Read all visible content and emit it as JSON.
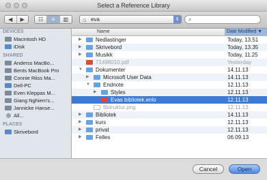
{
  "window": {
    "title": "Select a Reference Library"
  },
  "toolbar": {
    "nav": [
      "◀",
      "▶"
    ],
    "views": [
      "☷",
      "≡",
      "▥"
    ],
    "path": "eva",
    "search_placeholder": ""
  },
  "sidebar": {
    "devices_header": "DEVICES",
    "devices": [
      "Macintosh HD",
      "iDisk"
    ],
    "shared_header": "SHARED",
    "shared": [
      "Anderss MacBo...",
      "Bents MacBook Pro",
      "Connie Riiss Ma...",
      "Dell-PC",
      "Even Kleppas M...",
      "Giang Nghiem's...",
      "Jannicke Hanse...",
      "All..."
    ],
    "places_header": "PLACES",
    "places": [
      "Skrivebord"
    ]
  },
  "list": {
    "col_name": "Name",
    "col_date": "Date Modified ▼",
    "rows": [
      {
        "name": "Nedlastinger",
        "date": "Today, 13.51"
      },
      {
        "name": "Skrivebord",
        "date": "Today, 13.35"
      },
      {
        "name": "Musikk",
        "date": "Today, 11.25"
      },
      {
        "name": "71498010.pdf",
        "date": "Yesterday"
      },
      {
        "name": "Dokumenter",
        "date": "14.11.13"
      },
      {
        "name": "Microsoft User Data",
        "date": "14.11.13"
      },
      {
        "name": "Endnote",
        "date": "12.11.13"
      },
      {
        "name": "Styles",
        "date": "12.11.13"
      },
      {
        "name": "Evas bibliotek.enlo",
        "date": "12.11.13"
      },
      {
        "name": "filstruktur.png",
        "date": "12.11.13"
      },
      {
        "name": "Bibliotek",
        "date": "14.11.13"
      },
      {
        "name": "kurs",
        "date": "12.11.13"
      },
      {
        "name": "privat",
        "date": "12.11.13"
      },
      {
        "name": "Felles",
        "date": "06.09.13"
      }
    ]
  },
  "buttons": {
    "cancel": "Cancel",
    "open": "Open"
  }
}
